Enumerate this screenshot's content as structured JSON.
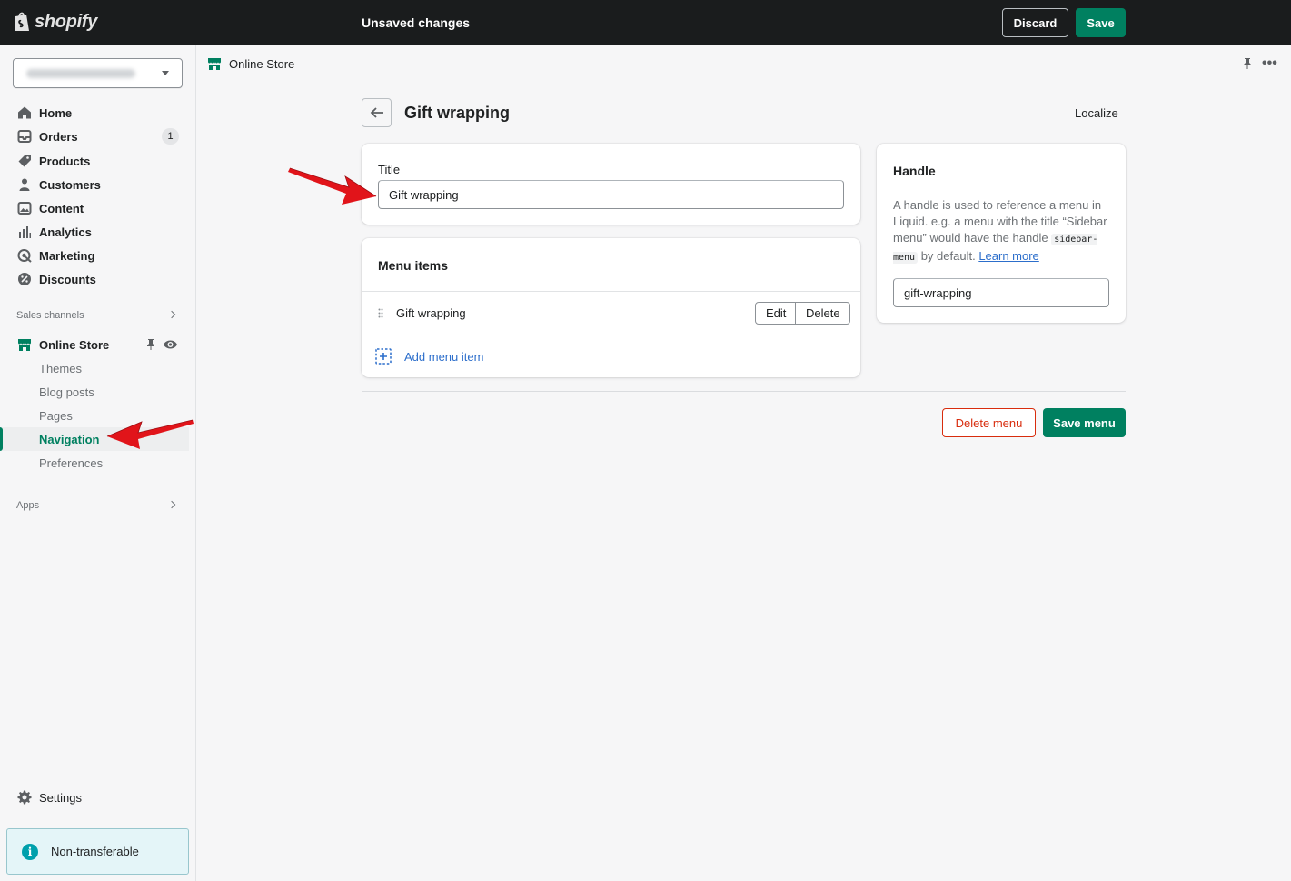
{
  "topbar": {
    "brand": "shopify",
    "status": "Unsaved changes",
    "discard_label": "Discard",
    "save_label": "Save"
  },
  "sidebar": {
    "nav": [
      {
        "label": "Home",
        "icon": "home-icon"
      },
      {
        "label": "Orders",
        "icon": "orders-icon",
        "badge": "1"
      },
      {
        "label": "Products",
        "icon": "tag-icon"
      },
      {
        "label": "Customers",
        "icon": "person-icon"
      },
      {
        "label": "Content",
        "icon": "image-icon"
      },
      {
        "label": "Analytics",
        "icon": "bar-chart-icon"
      },
      {
        "label": "Marketing",
        "icon": "target-icon"
      },
      {
        "label": "Discounts",
        "icon": "discount-icon"
      }
    ],
    "sales_channels_label": "Sales channels",
    "online_store_label": "Online Store",
    "online_store_sub": [
      {
        "label": "Themes"
      },
      {
        "label": "Blog posts"
      },
      {
        "label": "Pages"
      },
      {
        "label": "Navigation",
        "active": true
      },
      {
        "label": "Preferences"
      }
    ],
    "apps_label": "Apps",
    "settings_label": "Settings",
    "banner_label": "Non-transferable"
  },
  "subheader": {
    "title": "Online Store"
  },
  "main": {
    "page_title": "Gift wrapping",
    "localize_label": "Localize",
    "title_card": {
      "label": "Title",
      "value": "Gift wrapping"
    },
    "menu_card": {
      "heading": "Menu items",
      "items": [
        {
          "label": "Gift wrapping",
          "edit_label": "Edit",
          "delete_label": "Delete"
        }
      ],
      "add_label": "Add menu item"
    },
    "handle_card": {
      "heading": "Handle",
      "text_before": "A handle is used to reference a menu in Liquid. e.g. a menu with the title “Sidebar menu” would have the handle ",
      "code": "sidebar-menu",
      "text_after": " by default. ",
      "link_label": "Learn more",
      "value": "gift-wrapping"
    },
    "delete_menu_label": "Delete menu",
    "save_menu_label": "Save menu"
  },
  "colors": {
    "topbar": "#1a1c1d",
    "primary": "#008060",
    "critical": "#d82c0d",
    "link": "#2c6ecb",
    "annotation_arrow": "#e1141a"
  }
}
